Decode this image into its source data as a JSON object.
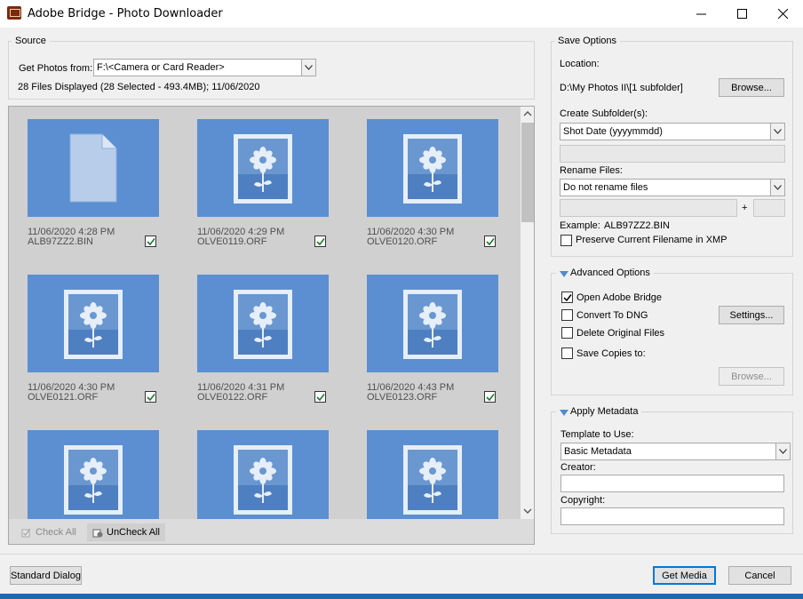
{
  "window": {
    "title": "Adobe Bridge - Photo Downloader"
  },
  "source": {
    "group_title": "Source",
    "get_photos_label": "Get Photos from:",
    "get_photos_value": "F:\\<Camera or Card Reader>",
    "status": "28 Files Displayed (28 Selected - 493.4MB); 11/06/2020"
  },
  "thumbnails": [
    {
      "date": "11/06/2020 4:28 PM",
      "name": "ALB97ZZ2.BIN",
      "checked": true,
      "kind": "document"
    },
    {
      "date": "11/06/2020 4:29 PM",
      "name": "OLVE0119.ORF",
      "checked": true,
      "kind": "photo"
    },
    {
      "date": "11/06/2020 4:30 PM",
      "name": "OLVE0120.ORF",
      "checked": true,
      "kind": "photo"
    },
    {
      "date": "11/06/2020 4:30 PM",
      "name": "OLVE0121.ORF",
      "checked": true,
      "kind": "photo"
    },
    {
      "date": "11/06/2020 4:31 PM",
      "name": "OLVE0122.ORF",
      "checked": true,
      "kind": "photo"
    },
    {
      "date": "11/06/2020 4:43 PM",
      "name": "OLVE0123.ORF",
      "checked": true,
      "kind": "photo"
    },
    {
      "date": "",
      "name": "",
      "checked": true,
      "kind": "photo"
    },
    {
      "date": "",
      "name": "",
      "checked": true,
      "kind": "photo"
    },
    {
      "date": "",
      "name": "",
      "checked": true,
      "kind": "photo"
    }
  ],
  "grid_buttons": {
    "check_all": "Check All",
    "uncheck_all": "UnCheck All"
  },
  "save_options": {
    "group_title": "Save Options",
    "location_label": "Location:",
    "location_value": "D:\\My Photos II\\[1 subfolder]",
    "browse": "Browse...",
    "create_subfolders_label": "Create Subfolder(s):",
    "create_subfolders_value": "Shot Date (yyyymmdd)",
    "rename_label": "Rename Files:",
    "rename_value": "Do not rename files",
    "plus": "+",
    "example_label": "Example:",
    "example_value": "ALB97ZZ2.BIN",
    "preserve_label": "Preserve Current Filename in XMP",
    "preserve_checked": false
  },
  "advanced_options": {
    "group_title": "Advanced Options",
    "open_bridge": "Open Adobe Bridge",
    "open_bridge_checked": true,
    "convert_dng": "Convert To DNG",
    "convert_dng_checked": false,
    "settings": "Settings...",
    "delete_originals": "Delete Original Files",
    "delete_originals_checked": false,
    "save_copies": "Save Copies to:",
    "save_copies_checked": false,
    "browse_disabled": "Browse..."
  },
  "apply_metadata": {
    "group_title": "Apply Metadata",
    "template_label": "Template to Use:",
    "template_value": "Basic Metadata",
    "creator_label": "Creator:",
    "creator_value": "",
    "copyright_label": "Copyright:",
    "copyright_value": ""
  },
  "footer": {
    "standard_dialog": "Standard Dialog",
    "get_media": "Get Media",
    "cancel": "Cancel"
  },
  "colors": {
    "thumb_bg": "#5b8fd2",
    "accent": "#0078d7",
    "grid_bg": "#d0d0d0"
  }
}
